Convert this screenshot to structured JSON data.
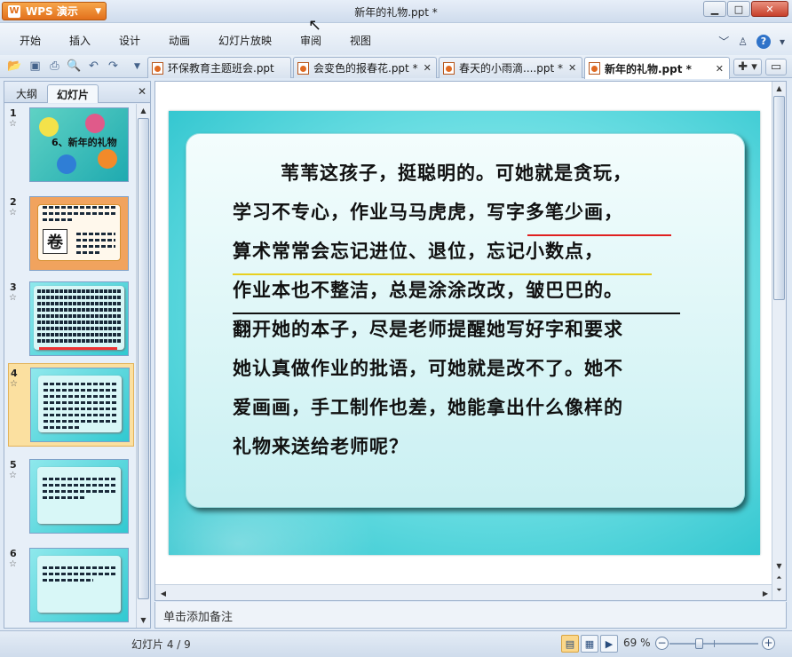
{
  "app": {
    "name": "WPS 演示",
    "window_title": "新年的礼物.ppt *"
  },
  "menu": [
    "开始",
    "插入",
    "设计",
    "动画",
    "幻灯片放映",
    "审阅",
    "视图"
  ],
  "toolbar": {
    "icons": [
      "open-icon",
      "save-icon",
      "print-icon",
      "print-preview-icon",
      "undo-icon",
      "redo-icon"
    ]
  },
  "doc_tabs": [
    {
      "label": "环保教育主题班会.ppt",
      "active": false
    },
    {
      "label": "会变色的报春花.ppt *",
      "active": false
    },
    {
      "label": "春天的小雨滴....ppt *",
      "active": false
    },
    {
      "label": "新年的礼物.ppt *",
      "active": true
    }
  ],
  "left_pane": {
    "tabs": [
      "大纲",
      "幻灯片"
    ],
    "active_tab": "幻灯片",
    "slides": [
      {
        "num": "1",
        "title": "6、新年的礼物"
      },
      {
        "num": "2",
        "title": "",
        "icon_char": "卷"
      },
      {
        "num": "3",
        "title": ""
      },
      {
        "num": "4",
        "title": "",
        "selected": true
      },
      {
        "num": "5",
        "title": ""
      },
      {
        "num": "6",
        "title": ""
      }
    ]
  },
  "slide": {
    "lines": [
      "苇苇这孩子，挺聪明的。可她就是贪玩，",
      "学习不专心，作业马马虎虎，写字多笔少画，",
      "算术常常会忘记进位、退位，忘记小数点，",
      "作业本也不整洁，总是涂涂改改，皱巴巴的。",
      "翻开她的本子，尽是老师提醒她写好字和要求",
      "她认真做作业的批语，可她就是改不了。她不",
      "爱画画，手工制作也差，她能拿出什么像样的",
      "礼物来送给老师呢？"
    ],
    "underline_colors": [
      "#e02020",
      "#e8d020",
      "#111111"
    ]
  },
  "notes_placeholder": "单击添加备注",
  "status": {
    "slide_counter": "幻灯片 4 / 9",
    "zoom": "69 %",
    "zoom_level_percent": 69
  }
}
